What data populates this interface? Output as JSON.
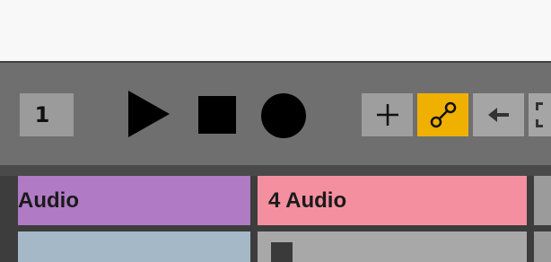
{
  "transport": {
    "bar_field": "1",
    "play_icon": "play-icon",
    "stop_icon": "stop-icon",
    "record_icon": "record-icon",
    "add_icon": "plus-icon",
    "link_icon": "link-icon",
    "back_icon": "arrow-left-icon",
    "cut_icon": "bracket-icon",
    "colors": {
      "bar_bg": "#6f6f6f",
      "link_active": "#f0b000"
    }
  },
  "tracks": [
    {
      "name": "Audio",
      "color": "#b07ac4"
    },
    {
      "name": "4 Audio",
      "color": "#f48fa0"
    }
  ]
}
